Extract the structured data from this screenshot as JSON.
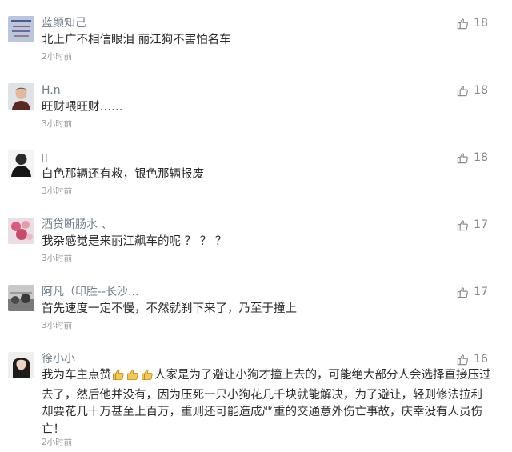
{
  "comments": [
    {
      "username": "蓝颜知己",
      "text": "北上广不相信眼泪 丽江狗不害怕名车",
      "time": "2小时前",
      "likes": "18",
      "avatar": "avatar-1"
    },
    {
      "username": "H.n",
      "text": "旺财喂旺财……",
      "time": "3小时前",
      "likes": "18",
      "avatar": "avatar-2"
    },
    {
      "username": "▯",
      "text": "白色那辆还有救，银色那辆报废",
      "time": "3小时前",
      "likes": "18",
      "avatar": "avatar-3"
    },
    {
      "username": "酒贷断肠水 、",
      "text": "我杂感觉是来丽江飙车的呢 ？ ？ ？",
      "time": "3小时前",
      "likes": "17",
      "avatar": "avatar-4"
    },
    {
      "username": "阿凡（印胜--长沙...",
      "text": "首先速度一定不慢，不然就刹下来了，乃至于撞上",
      "time": "3小时前",
      "likes": "17",
      "avatar": "avatar-5"
    },
    {
      "username": "徐小小",
      "text_before": "我为车主点赞",
      "text_after": "人家是为了避让小狗才撞上去的，可能绝大部分人会选择直接压过去了，然后他并没有，因为压死一只小狗花几千块就能解决，为了避让，轻则修法拉利却要花几十万甚至上百万，重则还可能造成严重的交通意外伤亡事故，庆幸没有人员伤亡！",
      "time": "2小时前",
      "likes": "16",
      "avatar": "avatar-6"
    }
  ],
  "icons": {
    "like": "thumbs-up-outline-icon",
    "emoji": "thumbs-up-emoji-icon"
  },
  "colors": {
    "username": "#6f7d8c",
    "text": "#2b2b2b",
    "time": "#9a9a9a",
    "likes": "#888888"
  }
}
